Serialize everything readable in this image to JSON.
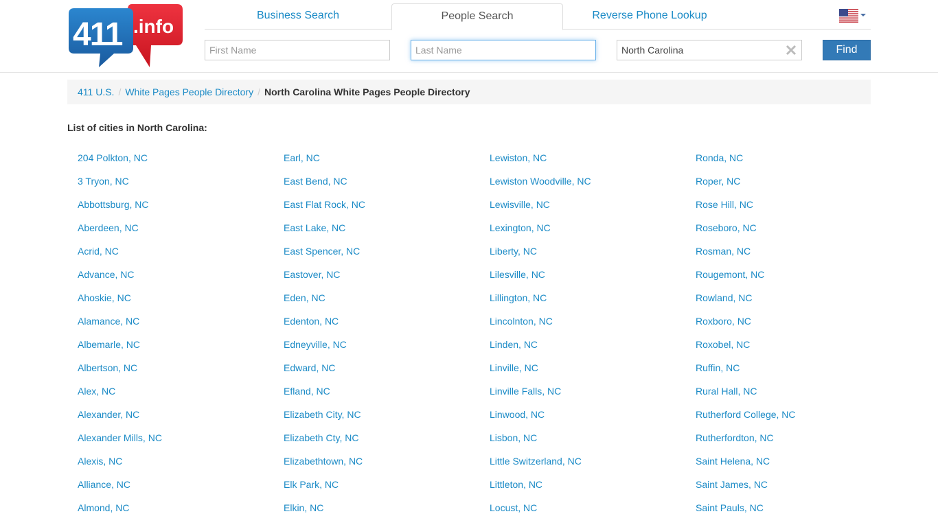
{
  "header": {
    "logo_text_main": "411",
    "logo_text_suffix": ".info",
    "tabs": [
      {
        "label": "Business Search",
        "active": false
      },
      {
        "label": "People Search",
        "active": true
      },
      {
        "label": "Reverse Phone Lookup",
        "active": false
      }
    ],
    "country_flag": "us-flag-icon",
    "search": {
      "first_name_placeholder": "First Name",
      "first_name_value": "",
      "last_name_placeholder": "Last Name",
      "last_name_value": "",
      "state_value": "North Carolina",
      "find_label": "Find"
    }
  },
  "colors": {
    "link": "#1a8ac6",
    "button": "#337ab7",
    "logo_blue": "#1f6fb5",
    "logo_red": "#e0202f"
  },
  "breadcrumb": {
    "items": [
      {
        "label": "411 U.S."
      },
      {
        "label": "White Pages People Directory"
      }
    ],
    "separator": "/",
    "current": "North Carolina White Pages People Directory"
  },
  "main": {
    "list_title": "List of cities in North Carolina:",
    "columns": [
      [
        "204 Polkton, NC",
        "3 Tryon, NC",
        "Abbottsburg, NC",
        "Aberdeen, NC",
        "Acrid, NC",
        "Advance, NC",
        "Ahoskie, NC",
        "Alamance, NC",
        "Albemarle, NC",
        "Albertson, NC",
        "Alex, NC",
        "Alexander, NC",
        "Alexander Mills, NC",
        "Alexis, NC",
        "Alliance, NC",
        "Almond, NC"
      ],
      [
        "Earl, NC",
        "East Bend, NC",
        "East Flat Rock, NC",
        "East Lake, NC",
        "East Spencer, NC",
        "Eastover, NC",
        "Eden, NC",
        "Edenton, NC",
        "Edneyville, NC",
        "Edward, NC",
        "Efland, NC",
        "Elizabeth City, NC",
        "Elizabeth Cty, NC",
        "Elizabethtown, NC",
        "Elk Park, NC",
        "Elkin, NC"
      ],
      [
        "Lewiston, NC",
        "Lewiston Woodville, NC",
        "Lewisville, NC",
        "Lexington, NC",
        "Liberty, NC",
        "Lilesville, NC",
        "Lillington, NC",
        "Lincolnton, NC",
        "Linden, NC",
        "Linville, NC",
        "Linville Falls, NC",
        "Linwood, NC",
        "Lisbon, NC",
        "Little Switzerland, NC",
        "Littleton, NC",
        "Locust, NC"
      ],
      [
        "Ronda, NC",
        "Roper, NC",
        "Rose Hill, NC",
        "Roseboro, NC",
        "Rosman, NC",
        "Rougemont, NC",
        "Rowland, NC",
        "Roxboro, NC",
        "Roxobel, NC",
        "Ruffin, NC",
        "Rural Hall, NC",
        "Rutherford College, NC",
        "Rutherfordton, NC",
        "Saint Helena, NC",
        "Saint James, NC",
        "Saint Pauls, NC"
      ]
    ]
  }
}
